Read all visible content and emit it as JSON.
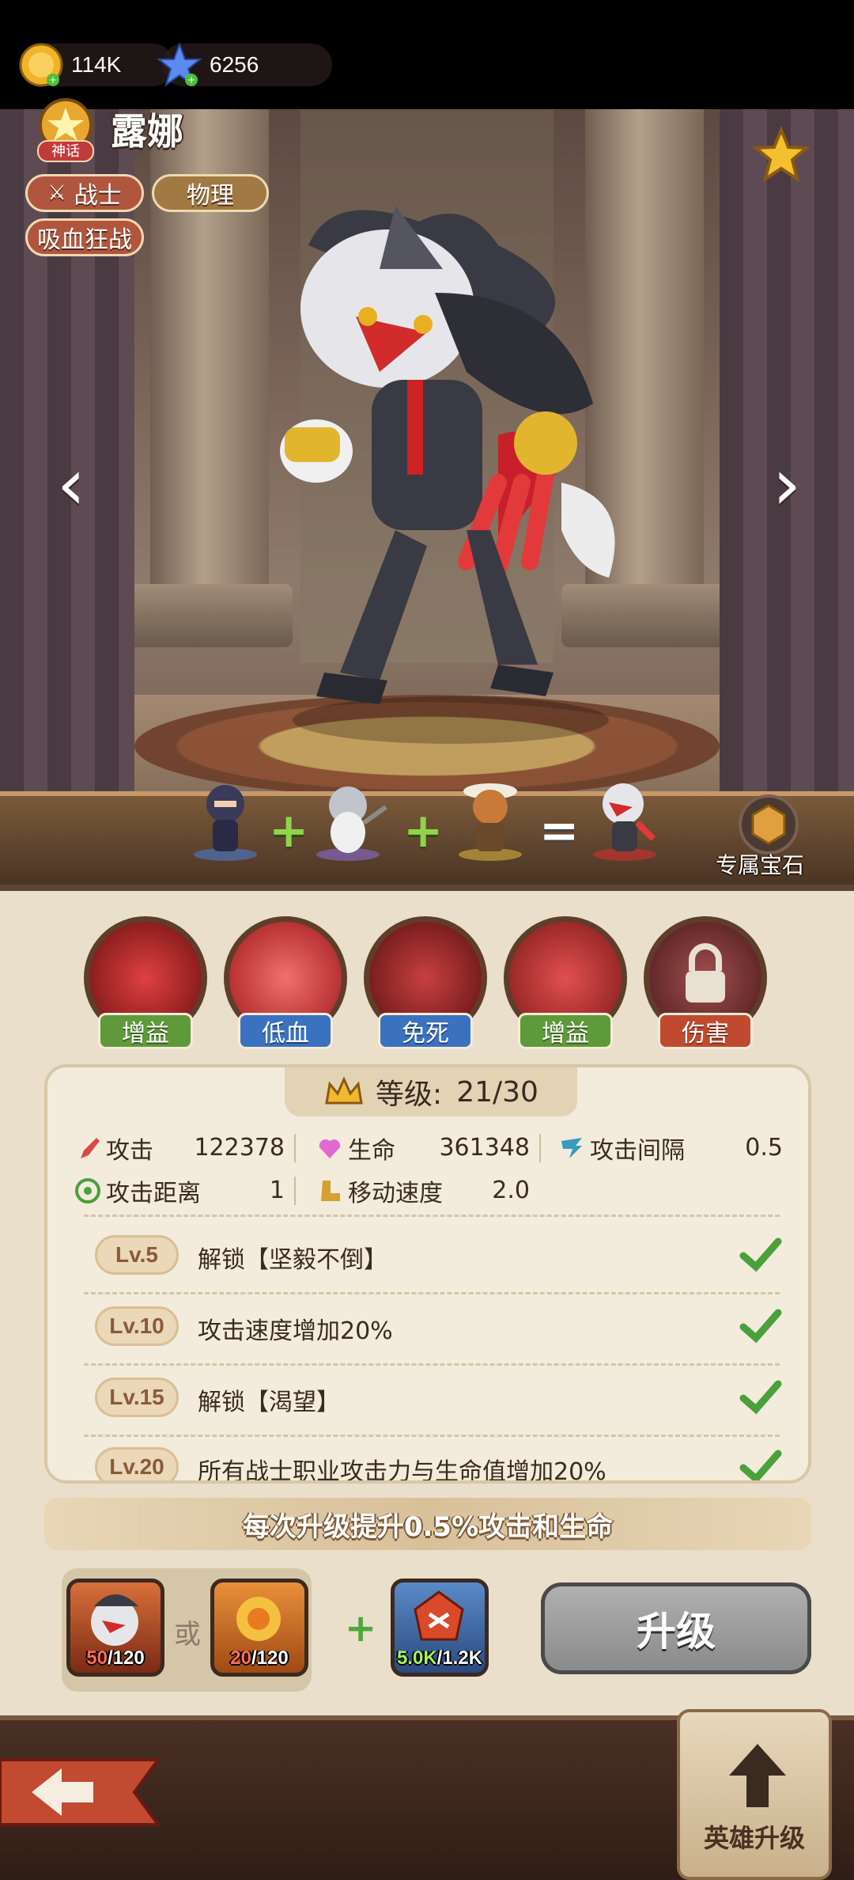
{
  "resources": {
    "gold": "114K",
    "gems": "6256"
  },
  "hero": {
    "rank_badge_text": "神话",
    "name": "露娜",
    "class_tag": "战士",
    "damage_tag": "物理",
    "trait_tag": "吸血狂战"
  },
  "fusion": {
    "exclusive_gem_label": "专属宝石"
  },
  "skills": [
    {
      "label": "增益",
      "color": "#5e9a3a"
    },
    {
      "label": "低血",
      "color": "#3a72c0"
    },
    {
      "label": "免死",
      "color": "#3a72c0"
    },
    {
      "label": "增益",
      "color": "#5e9a3a"
    },
    {
      "label": "伤害",
      "color": "#c04a30"
    }
  ],
  "level": {
    "label": "等级:",
    "value": "21/30"
  },
  "stats": {
    "attack_label": "攻击",
    "attack": "122378",
    "hp_label": "生命",
    "hp": "361348",
    "interval_label": "攻击间隔",
    "interval": "0.5",
    "range_label": "攻击距离",
    "range": "1",
    "speed_label": "移动速度",
    "speed": "2.0"
  },
  "unlocks": [
    {
      "level": "Lv.5",
      "text": "解锁【坚毅不倒】",
      "done": true
    },
    {
      "level": "Lv.10",
      "text": "攻击速度增加20%",
      "done": true
    },
    {
      "level": "Lv.15",
      "text": "解锁【渴望】",
      "done": true
    },
    {
      "level": "Lv.20",
      "text": "所有战士职业攻击力与生命值增加20%",
      "done": true
    }
  ],
  "banner": "每次升级提升0.5%攻击和生命",
  "cost": {
    "shard_have": "50",
    "shard_need": "/120",
    "alt_have": "20",
    "alt_need": "/120",
    "or_label": "或",
    "plus_label": "+",
    "exp_have": "5.0K",
    "exp_need": "/1.2K"
  },
  "upgrade_button": "升级",
  "bottom": {
    "hero_upgrade_label": "英雄升级"
  },
  "colors": {
    "accent_green": "#8fd44a",
    "panel_bg": "#eadfcb",
    "text_dark": "#3a2a20"
  }
}
